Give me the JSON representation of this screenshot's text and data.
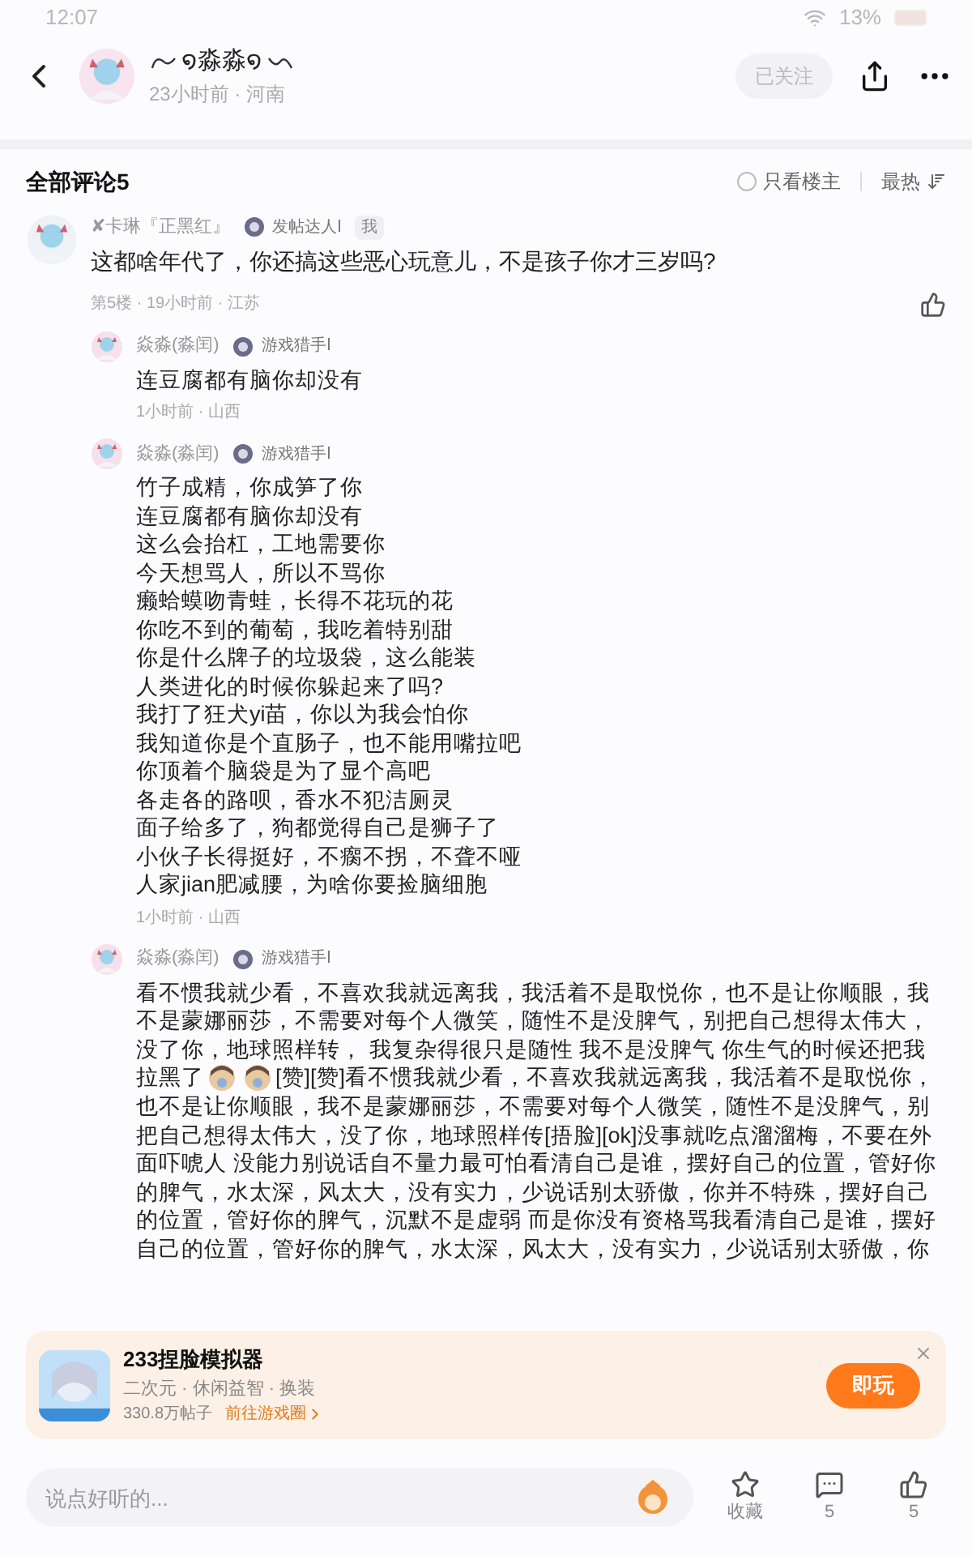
{
  "status_bar": {
    "time": "12:07",
    "battery": "13%"
  },
  "header": {
    "author": "໑淼淼໑",
    "meta": "23小时前 · 河南",
    "follow": {
      "label": "已关注",
      "disabled": true
    }
  },
  "comments_header": {
    "title": "全部评论5",
    "filter": {
      "label": "只看楼主",
      "checked": false
    },
    "sort": "最热"
  },
  "comment": {
    "name": "✘卡琳『正黑红』",
    "badge": "发帖达人Ⅰ",
    "tag": "我",
    "text": "这都啥年代了，你还搞这些恶心玩意儿，不是孩子你才三岁吗?",
    "meta": "第5楼 · 19小时前 · 江苏"
  },
  "replies": [
    {
      "name": "焱淼(淼闰)",
      "badge": "游戏猎手Ⅰ",
      "segments": [
        {
          "kind": "text",
          "text": "连豆腐都有脑你却没有"
        }
      ],
      "meta": "1小时前 · 山西"
    },
    {
      "name": "焱淼(淼闰)",
      "badge": "游戏猎手Ⅰ",
      "segments": [
        {
          "kind": "lines",
          "lines": [
            "竹子成精，你成笋了你",
            "连豆腐都有脑你却没有",
            "这么会抬杠，工地需要你",
            "今天想骂人，所以不骂你",
            "癞蛤蟆吻青蛙，长得不花玩的花",
            "你吃不到的葡萄，我吃着特别甜",
            "你是什么牌子的垃圾袋，这么能装",
            "人类进化的时候你躲起来了吗?",
            "我打了狂犬yi苗，你以为我会怕你",
            "我知道你是个直肠子，也不能用嘴拉吧",
            "你顶着个脑袋是为了显个高吧",
            "各走各的路呗，香水不犯洁厕灵",
            "面子给多了，狗都觉得自己是狮子了",
            "小伙子长得挺好，不瘸不拐，不聋不哑",
            "人家jian肥减腰，为啥你要捡脑细胞"
          ]
        }
      ],
      "meta": "1小时前 · 山西"
    },
    {
      "name": "焱淼(淼闰)",
      "badge": "游戏猎手Ⅰ",
      "segments": [
        {
          "kind": "text",
          "text": "看不惯我就少看，不喜欢我就远离我，我活着不是取悦你，也不是让你顺眼，我不是蒙娜丽莎，不需要对每个人微笑，随性不是没脾气，别把自己想得太伟大，没了你，地球照样转， 我复杂得很只是随性 我不是没脾气 你生气的时候还把我拉黑了"
        },
        {
          "kind": "sticker"
        },
        {
          "kind": "sticker"
        },
        {
          "kind": "text",
          "text": "[赞][赞]看不惯我就少看，不喜欢我就远离我，我活着不是取悦你，也不是让你顺眼，我不是蒙娜丽莎，不需要对每个人微笑，随性不是没脾气，别把自己想得太伟大，没了你，地球照样传[捂脸][ok]没事就吃点溜溜梅，不要在外面吓唬人 没能力别说话自不量力最可怕看清自己是谁，摆好自己的位置，管好你的脾气，水太深，风太大，没有实力，少说话别太骄傲，你并不特殊，摆好自己的位置，管好你的脾气，沉默不是虚弱 而是你没有资格骂我看清自己是谁，摆好自己的位置，管好你的脾气，水太深，风太大，没有实力，少说话别太骄傲，你"
        }
      ]
    }
  ],
  "ad": {
    "title": "233捏脸模拟器",
    "tags": "二次元 · 休闲益智 · 换装",
    "posts": "330.8万帖子",
    "link": "前往游戏圈",
    "button": "即玩"
  },
  "bottom_bar": {
    "placeholder": "说点好听的...",
    "favorite": "收藏",
    "comments": "5",
    "likes": "5"
  }
}
